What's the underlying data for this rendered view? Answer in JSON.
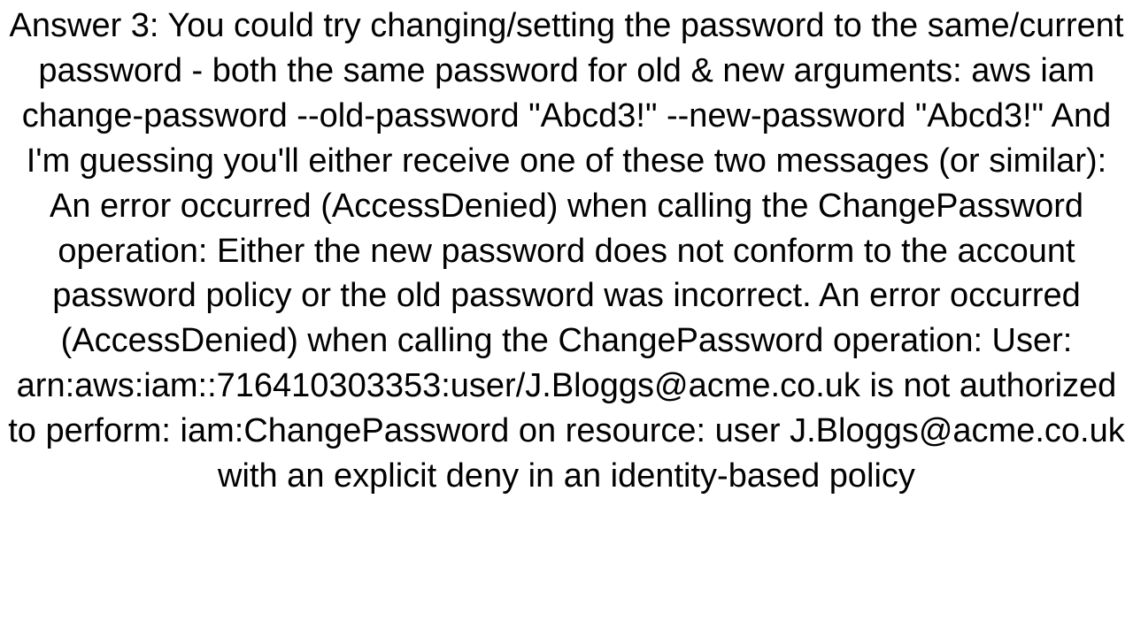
{
  "answer": {
    "text": "Answer 3: You could try changing/setting the password to the same/current password - both the same password for old & new arguments: aws iam change-password --old-password \"Abcd3!\" --new-password \"Abcd3!\"  And I'm guessing you'll either receive one of these two messages (or similar): An error occurred (AccessDenied) when calling the ChangePassword operation: Either the new password does not conform to the account password policy or the old password was incorrect.  An error occurred (AccessDenied) when calling the ChangePassword operation: User: arn:aws:iam::716410303353:user/J.Bloggs@acme.co.uk is not authorized to perform: iam:ChangePassword on resource: user J.Bloggs@acme.co.uk with an explicit deny in an identity-based policy"
  }
}
